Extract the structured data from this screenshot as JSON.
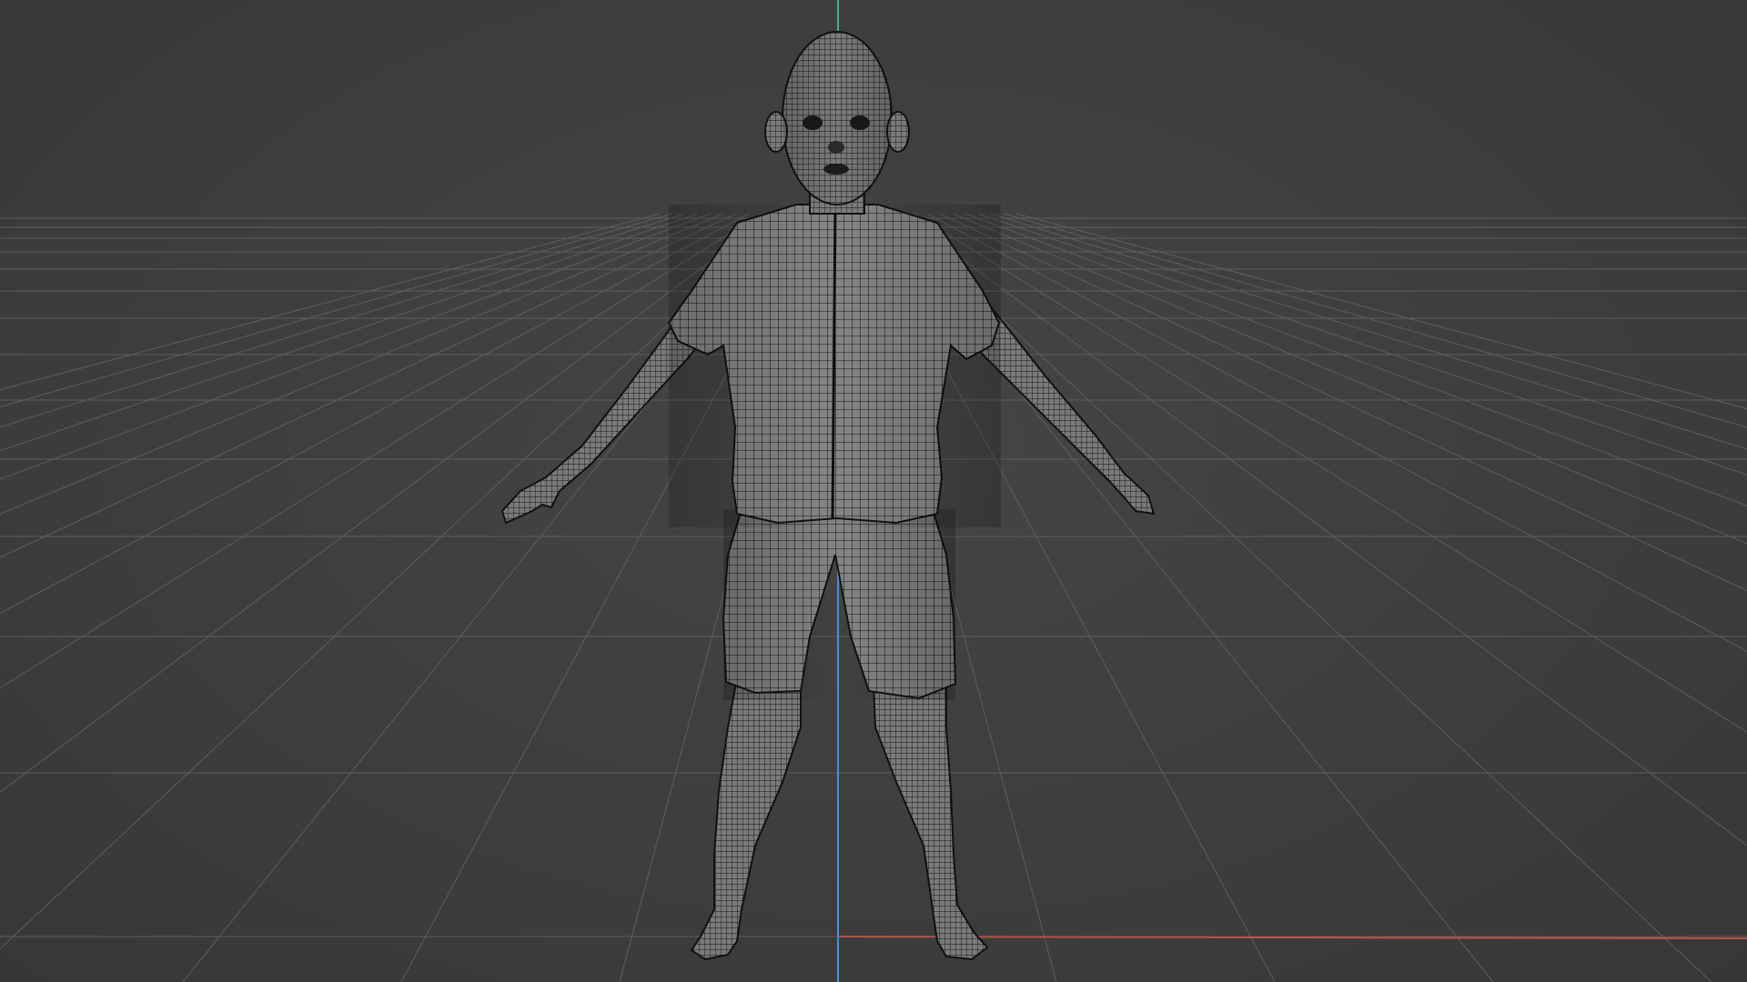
{
  "scene": {
    "view": "front-orthographic",
    "object": "child-character-base-mesh",
    "shading": "wireframe-over-solid",
    "grid_visible": true,
    "axes_visible": [
      "x",
      "z"
    ]
  },
  "colors": {
    "background": "#3f3f3f",
    "grid_line": "#5a5a5a",
    "x_axis": "#c0503f",
    "z_axis_top": "#4cae8a",
    "z_axis_bottom": "#4a8fd8",
    "mesh_fill": "#7d7d7d",
    "mesh_wire": "#141414"
  }
}
